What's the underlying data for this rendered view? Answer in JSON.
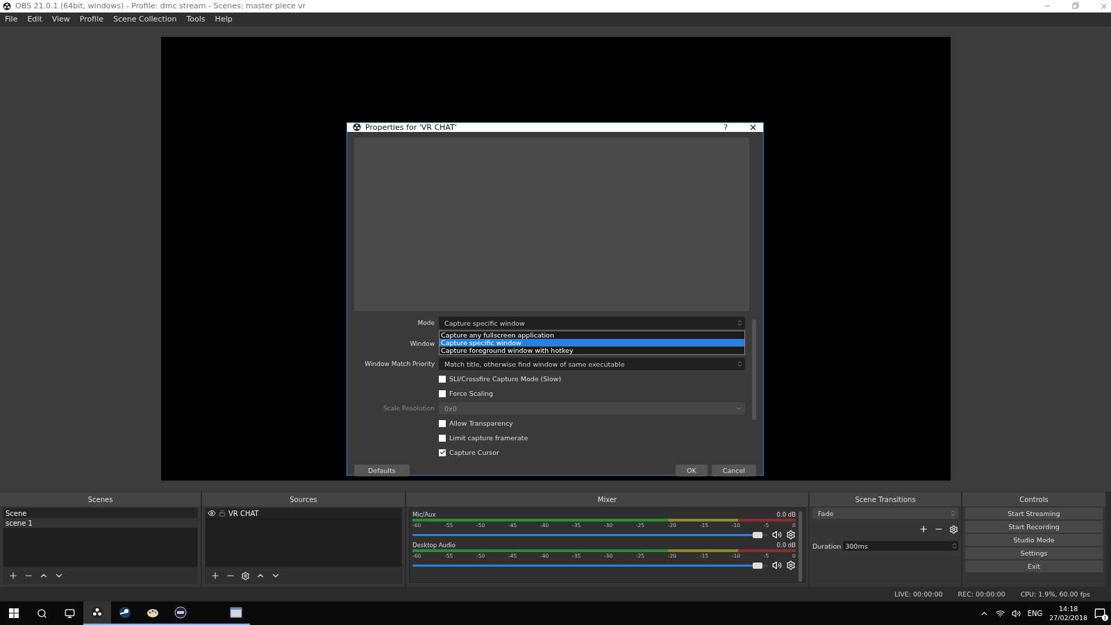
{
  "window": {
    "title": "OBS 21.0.1 (64bit, windows) - Profile: dmc stream - Scenes: master piece vr"
  },
  "menu": [
    "File",
    "Edit",
    "View",
    "Profile",
    "Scene Collection",
    "Tools",
    "Help"
  ],
  "dialog": {
    "title": "Properties for 'VR CHAT'",
    "help": "?",
    "fields": [
      {
        "kind": "select",
        "label": "Mode",
        "value": "Capture specific window",
        "disabled": false,
        "expanded": true,
        "options": [
          {
            "label": "Capture any fullscreen application",
            "selected": false
          },
          {
            "label": "Capture specific window",
            "selected": true
          },
          {
            "label": "Capture foreground window with hotkey",
            "selected": false
          }
        ]
      },
      {
        "kind": "covered",
        "label": "Window"
      },
      {
        "kind": "select",
        "label": "Window Match Priority",
        "value": "Match title, otherwise find window of same executable",
        "disabled": false,
        "expanded": false
      },
      {
        "kind": "check",
        "label": "SLI/Crossfire Capture Mode (Slow)",
        "checked": false
      },
      {
        "kind": "check",
        "label": "Force Scaling",
        "checked": false
      },
      {
        "kind": "select",
        "label": "Scale Resolution",
        "value": "0x0",
        "disabled": true,
        "expanded": false
      },
      {
        "kind": "check",
        "label": "Allow Transparency",
        "checked": false
      },
      {
        "kind": "check",
        "label": "Limit capture framerate",
        "checked": false
      },
      {
        "kind": "check",
        "label": "Capture Cursor",
        "checked": true
      }
    ],
    "buttons": [
      "Defaults",
      "OK",
      "Cancel"
    ]
  },
  "scenes": {
    "title": "Scenes",
    "items": [
      {
        "label": "Scene",
        "selected": false
      },
      {
        "label": "scene 1",
        "selected": true
      }
    ]
  },
  "sources": {
    "title": "Sources",
    "items": [
      {
        "label": "VR CHAT",
        "visible": true,
        "locked": false
      }
    ]
  },
  "mixer": {
    "title": "Mixer",
    "channels": [
      {
        "name": "Mic/Aux",
        "reading": "0.0 dB",
        "level": 0.98,
        "muted": false,
        "ticks": [
          "-60",
          "-55",
          "-50",
          "-45",
          "-40",
          "-35",
          "-30",
          "-25",
          "-20",
          "-15",
          "-10",
          "-5",
          "0"
        ]
      },
      {
        "name": "Desktop Audio",
        "reading": "0.0 dB",
        "level": 0.98,
        "muted": false,
        "ticks": [
          "-60",
          "-55",
          "-50",
          "-45",
          "-40",
          "-35",
          "-30",
          "-25",
          "-20",
          "-15",
          "-10",
          "-5",
          "0"
        ]
      }
    ]
  },
  "transitions": {
    "title": "Scene Transitions",
    "value": "Fade",
    "duration_label": "Duration",
    "duration": "300ms"
  },
  "controls": {
    "title": "Controls",
    "buttons": [
      "Start Streaming",
      "Start Recording",
      "Studio Mode",
      "Settings",
      "Exit"
    ]
  },
  "status_bar": [
    "LIVE: 00:00:00",
    "REC: 00:00:00",
    "CPU: 1.9%, 60.00 fps"
  ],
  "taskbar": {
    "apps": [
      {
        "kind": "obs",
        "selected": true,
        "running": true
      },
      {
        "kind": "steam",
        "selected": false,
        "running": true
      },
      {
        "kind": "paint",
        "selected": false,
        "running": true
      },
      {
        "kind": "vr",
        "selected": false,
        "running": true
      },
      {
        "kind": "blank",
        "selected": false,
        "running": true
      },
      {
        "kind": "files",
        "selected": false,
        "running": true
      }
    ],
    "language": "ENG",
    "time": "14:18",
    "date": "27/02/2018",
    "notifications": "1"
  }
}
